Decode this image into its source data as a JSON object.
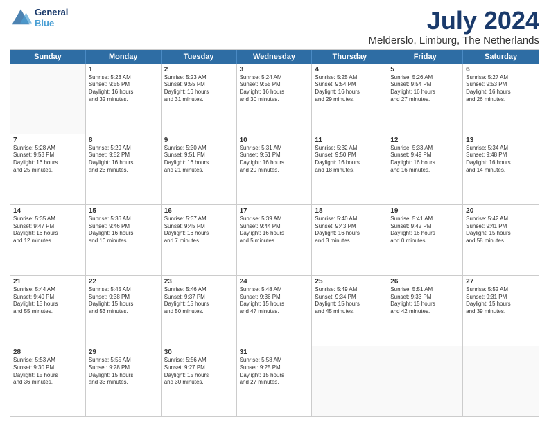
{
  "logo": {
    "line1": "General",
    "line2": "Blue"
  },
  "title": "July 2024",
  "subtitle": "Melderslo, Limburg, The Netherlands",
  "header_days": [
    "Sunday",
    "Monday",
    "Tuesday",
    "Wednesday",
    "Thursday",
    "Friday",
    "Saturday"
  ],
  "weeks": [
    [
      {
        "day": "",
        "lines": []
      },
      {
        "day": "1",
        "lines": [
          "Sunrise: 5:23 AM",
          "Sunset: 9:55 PM",
          "Daylight: 16 hours",
          "and 32 minutes."
        ]
      },
      {
        "day": "2",
        "lines": [
          "Sunrise: 5:23 AM",
          "Sunset: 9:55 PM",
          "Daylight: 16 hours",
          "and 31 minutes."
        ]
      },
      {
        "day": "3",
        "lines": [
          "Sunrise: 5:24 AM",
          "Sunset: 9:55 PM",
          "Daylight: 16 hours",
          "and 30 minutes."
        ]
      },
      {
        "day": "4",
        "lines": [
          "Sunrise: 5:25 AM",
          "Sunset: 9:54 PM",
          "Daylight: 16 hours",
          "and 29 minutes."
        ]
      },
      {
        "day": "5",
        "lines": [
          "Sunrise: 5:26 AM",
          "Sunset: 9:54 PM",
          "Daylight: 16 hours",
          "and 27 minutes."
        ]
      },
      {
        "day": "6",
        "lines": [
          "Sunrise: 5:27 AM",
          "Sunset: 9:53 PM",
          "Daylight: 16 hours",
          "and 26 minutes."
        ]
      }
    ],
    [
      {
        "day": "7",
        "lines": [
          "Sunrise: 5:28 AM",
          "Sunset: 9:53 PM",
          "Daylight: 16 hours",
          "and 25 minutes."
        ]
      },
      {
        "day": "8",
        "lines": [
          "Sunrise: 5:29 AM",
          "Sunset: 9:52 PM",
          "Daylight: 16 hours",
          "and 23 minutes."
        ]
      },
      {
        "day": "9",
        "lines": [
          "Sunrise: 5:30 AM",
          "Sunset: 9:51 PM",
          "Daylight: 16 hours",
          "and 21 minutes."
        ]
      },
      {
        "day": "10",
        "lines": [
          "Sunrise: 5:31 AM",
          "Sunset: 9:51 PM",
          "Daylight: 16 hours",
          "and 20 minutes."
        ]
      },
      {
        "day": "11",
        "lines": [
          "Sunrise: 5:32 AM",
          "Sunset: 9:50 PM",
          "Daylight: 16 hours",
          "and 18 minutes."
        ]
      },
      {
        "day": "12",
        "lines": [
          "Sunrise: 5:33 AM",
          "Sunset: 9:49 PM",
          "Daylight: 16 hours",
          "and 16 minutes."
        ]
      },
      {
        "day": "13",
        "lines": [
          "Sunrise: 5:34 AM",
          "Sunset: 9:48 PM",
          "Daylight: 16 hours",
          "and 14 minutes."
        ]
      }
    ],
    [
      {
        "day": "14",
        "lines": [
          "Sunrise: 5:35 AM",
          "Sunset: 9:47 PM",
          "Daylight: 16 hours",
          "and 12 minutes."
        ]
      },
      {
        "day": "15",
        "lines": [
          "Sunrise: 5:36 AM",
          "Sunset: 9:46 PM",
          "Daylight: 16 hours",
          "and 10 minutes."
        ]
      },
      {
        "day": "16",
        "lines": [
          "Sunrise: 5:37 AM",
          "Sunset: 9:45 PM",
          "Daylight: 16 hours",
          "and 7 minutes."
        ]
      },
      {
        "day": "17",
        "lines": [
          "Sunrise: 5:39 AM",
          "Sunset: 9:44 PM",
          "Daylight: 16 hours",
          "and 5 minutes."
        ]
      },
      {
        "day": "18",
        "lines": [
          "Sunrise: 5:40 AM",
          "Sunset: 9:43 PM",
          "Daylight: 16 hours",
          "and 3 minutes."
        ]
      },
      {
        "day": "19",
        "lines": [
          "Sunrise: 5:41 AM",
          "Sunset: 9:42 PM",
          "Daylight: 16 hours",
          "and 0 minutes."
        ]
      },
      {
        "day": "20",
        "lines": [
          "Sunrise: 5:42 AM",
          "Sunset: 9:41 PM",
          "Daylight: 15 hours",
          "and 58 minutes."
        ]
      }
    ],
    [
      {
        "day": "21",
        "lines": [
          "Sunrise: 5:44 AM",
          "Sunset: 9:40 PM",
          "Daylight: 15 hours",
          "and 55 minutes."
        ]
      },
      {
        "day": "22",
        "lines": [
          "Sunrise: 5:45 AM",
          "Sunset: 9:38 PM",
          "Daylight: 15 hours",
          "and 53 minutes."
        ]
      },
      {
        "day": "23",
        "lines": [
          "Sunrise: 5:46 AM",
          "Sunset: 9:37 PM",
          "Daylight: 15 hours",
          "and 50 minutes."
        ]
      },
      {
        "day": "24",
        "lines": [
          "Sunrise: 5:48 AM",
          "Sunset: 9:36 PM",
          "Daylight: 15 hours",
          "and 47 minutes."
        ]
      },
      {
        "day": "25",
        "lines": [
          "Sunrise: 5:49 AM",
          "Sunset: 9:34 PM",
          "Daylight: 15 hours",
          "and 45 minutes."
        ]
      },
      {
        "day": "26",
        "lines": [
          "Sunrise: 5:51 AM",
          "Sunset: 9:33 PM",
          "Daylight: 15 hours",
          "and 42 minutes."
        ]
      },
      {
        "day": "27",
        "lines": [
          "Sunrise: 5:52 AM",
          "Sunset: 9:31 PM",
          "Daylight: 15 hours",
          "and 39 minutes."
        ]
      }
    ],
    [
      {
        "day": "28",
        "lines": [
          "Sunrise: 5:53 AM",
          "Sunset: 9:30 PM",
          "Daylight: 15 hours",
          "and 36 minutes."
        ]
      },
      {
        "day": "29",
        "lines": [
          "Sunrise: 5:55 AM",
          "Sunset: 9:28 PM",
          "Daylight: 15 hours",
          "and 33 minutes."
        ]
      },
      {
        "day": "30",
        "lines": [
          "Sunrise: 5:56 AM",
          "Sunset: 9:27 PM",
          "Daylight: 15 hours",
          "and 30 minutes."
        ]
      },
      {
        "day": "31",
        "lines": [
          "Sunrise: 5:58 AM",
          "Sunset: 9:25 PM",
          "Daylight: 15 hours",
          "and 27 minutes."
        ]
      },
      {
        "day": "",
        "lines": []
      },
      {
        "day": "",
        "lines": []
      },
      {
        "day": "",
        "lines": []
      }
    ]
  ]
}
